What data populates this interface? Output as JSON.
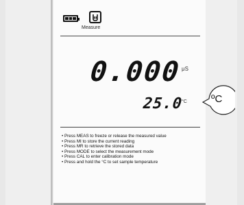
{
  "status": {
    "mode_label": "Measure",
    "battery_icon": "battery-full-icon",
    "mode_icon": "beaker-icon"
  },
  "reading": {
    "value": "0.000",
    "unit": "μS",
    "temperature": "25.0",
    "temperature_unit": "°C"
  },
  "callout": {
    "label": "ºC"
  },
  "instructions": [
    "Press MEAS to freeze or release the measured value",
    "Press MI to store the current reading",
    "Press MR to retrieve the stored data",
    "Press MODE to select the measurement mode",
    "Press CAL to enter calibration mode",
    "Press and hold the °C to set sample temperature"
  ],
  "colors": {
    "display_background": "#fbfbfb",
    "segment": "#111111",
    "frame": "#ececec"
  }
}
